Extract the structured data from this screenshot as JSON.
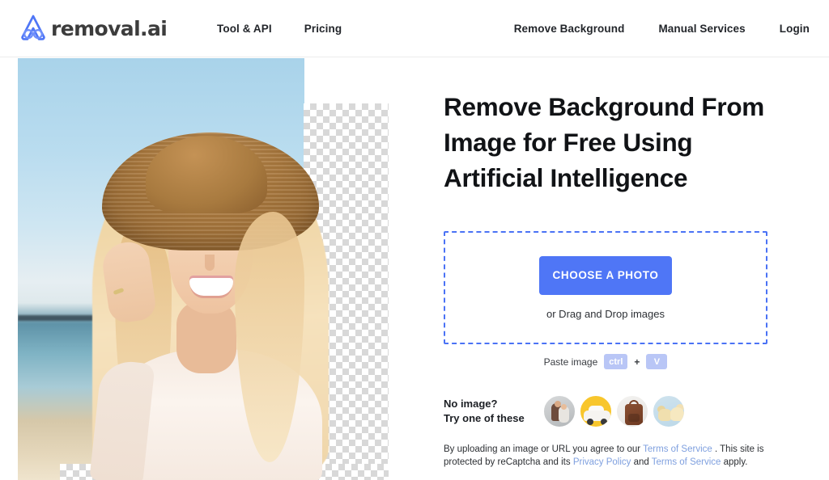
{
  "header": {
    "brand_name": "removal.ai",
    "logo_icon": "removal-ai-logo-icon",
    "nav_left": [
      {
        "label": "Tool & API"
      },
      {
        "label": "Pricing"
      }
    ],
    "nav_right": [
      {
        "label": "Remove Background"
      },
      {
        "label": "Manual Services"
      },
      {
        "label": "Login"
      }
    ]
  },
  "hero": {
    "image_alt": "Smiling blonde woman in straw hat at the beach with background partially removed showing transparency checkerboard"
  },
  "main": {
    "headline": "Remove Background From Image for Free Using Artificial Intelligence",
    "dropzone": {
      "button_label": "CHOOSE A PHOTO",
      "drag_text": "or Drag and Drop images"
    },
    "paste": {
      "label": "Paste image",
      "key_1": "ctrl",
      "separator": "+",
      "key_2": "V"
    },
    "samples": {
      "line_1": "No image?",
      "line_2": "Try one of these",
      "thumbs": [
        {
          "name": "sample-family-photo"
        },
        {
          "name": "sample-car-photo"
        },
        {
          "name": "sample-backpack-photo"
        },
        {
          "name": "sample-dogs-photo"
        }
      ]
    },
    "legal": {
      "part_1": "By uploading an image or URL you agree to our ",
      "link_1": "Terms of Service",
      "part_2": " . This site is protected by reCaptcha and its ",
      "link_2": "Privacy Policy",
      "part_3": " and ",
      "link_3": "Terms of Service",
      "part_4": " apply."
    }
  },
  "colors": {
    "accent_blue": "#4f76f6",
    "dropzone_border": "#4a72f5",
    "key_chip": "#b9c6f6",
    "link": "#7fa0df",
    "text": "#111316"
  }
}
